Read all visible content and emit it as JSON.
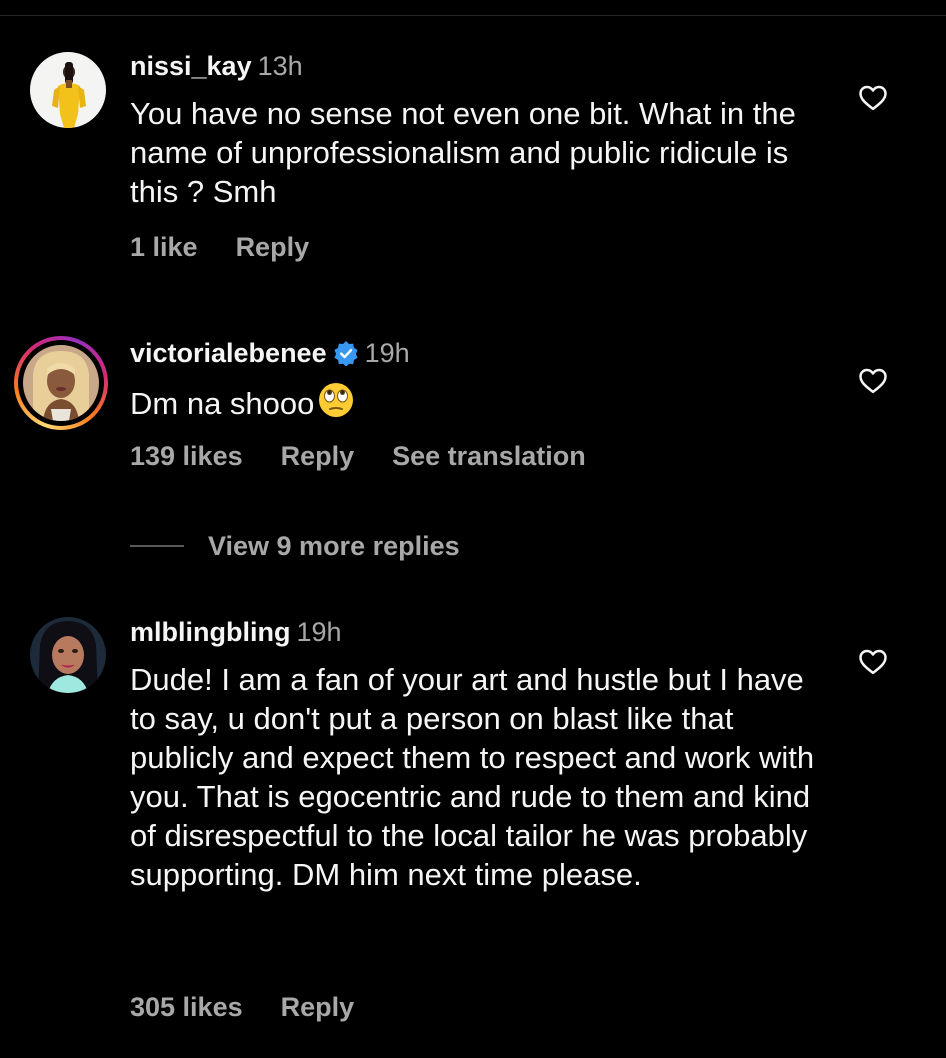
{
  "comments": [
    {
      "username": "nissi_kay",
      "time": "13h",
      "text": "You have no sense not even one bit. What in the name of unprofessionalism and public ridicule is this ? Smh",
      "likes": "1 like",
      "reply_label": "Reply"
    },
    {
      "username": "victorialebenee",
      "verified": true,
      "time": "19h",
      "text": "Dm na shooo",
      "emoji": "face-with-rolling-eyes",
      "likes": "139 likes",
      "reply_label": "Reply",
      "translation_label": "See translation"
    },
    {
      "username": "mlblingbling",
      "time": "19h",
      "text": "Dude! I am a fan of your art and hustle but I have to say, u don't put a person on blast like that publicly and expect them to respect and work with you. That is egocentric and rude to them and kind of disrespectful to the local tailor he was probably supporting.  DM him next time please.",
      "likes": "305 likes",
      "reply_label": "Reply"
    }
  ],
  "view_more_replies": "View 9 more replies",
  "colors": {
    "background": "#000000",
    "text_primary": "#f5f5f5",
    "text_secondary": "#a8a8a8",
    "verified_blue": "#3897f0"
  },
  "icons": {
    "like": "heart-outline-icon",
    "verified": "verified-badge-icon"
  }
}
